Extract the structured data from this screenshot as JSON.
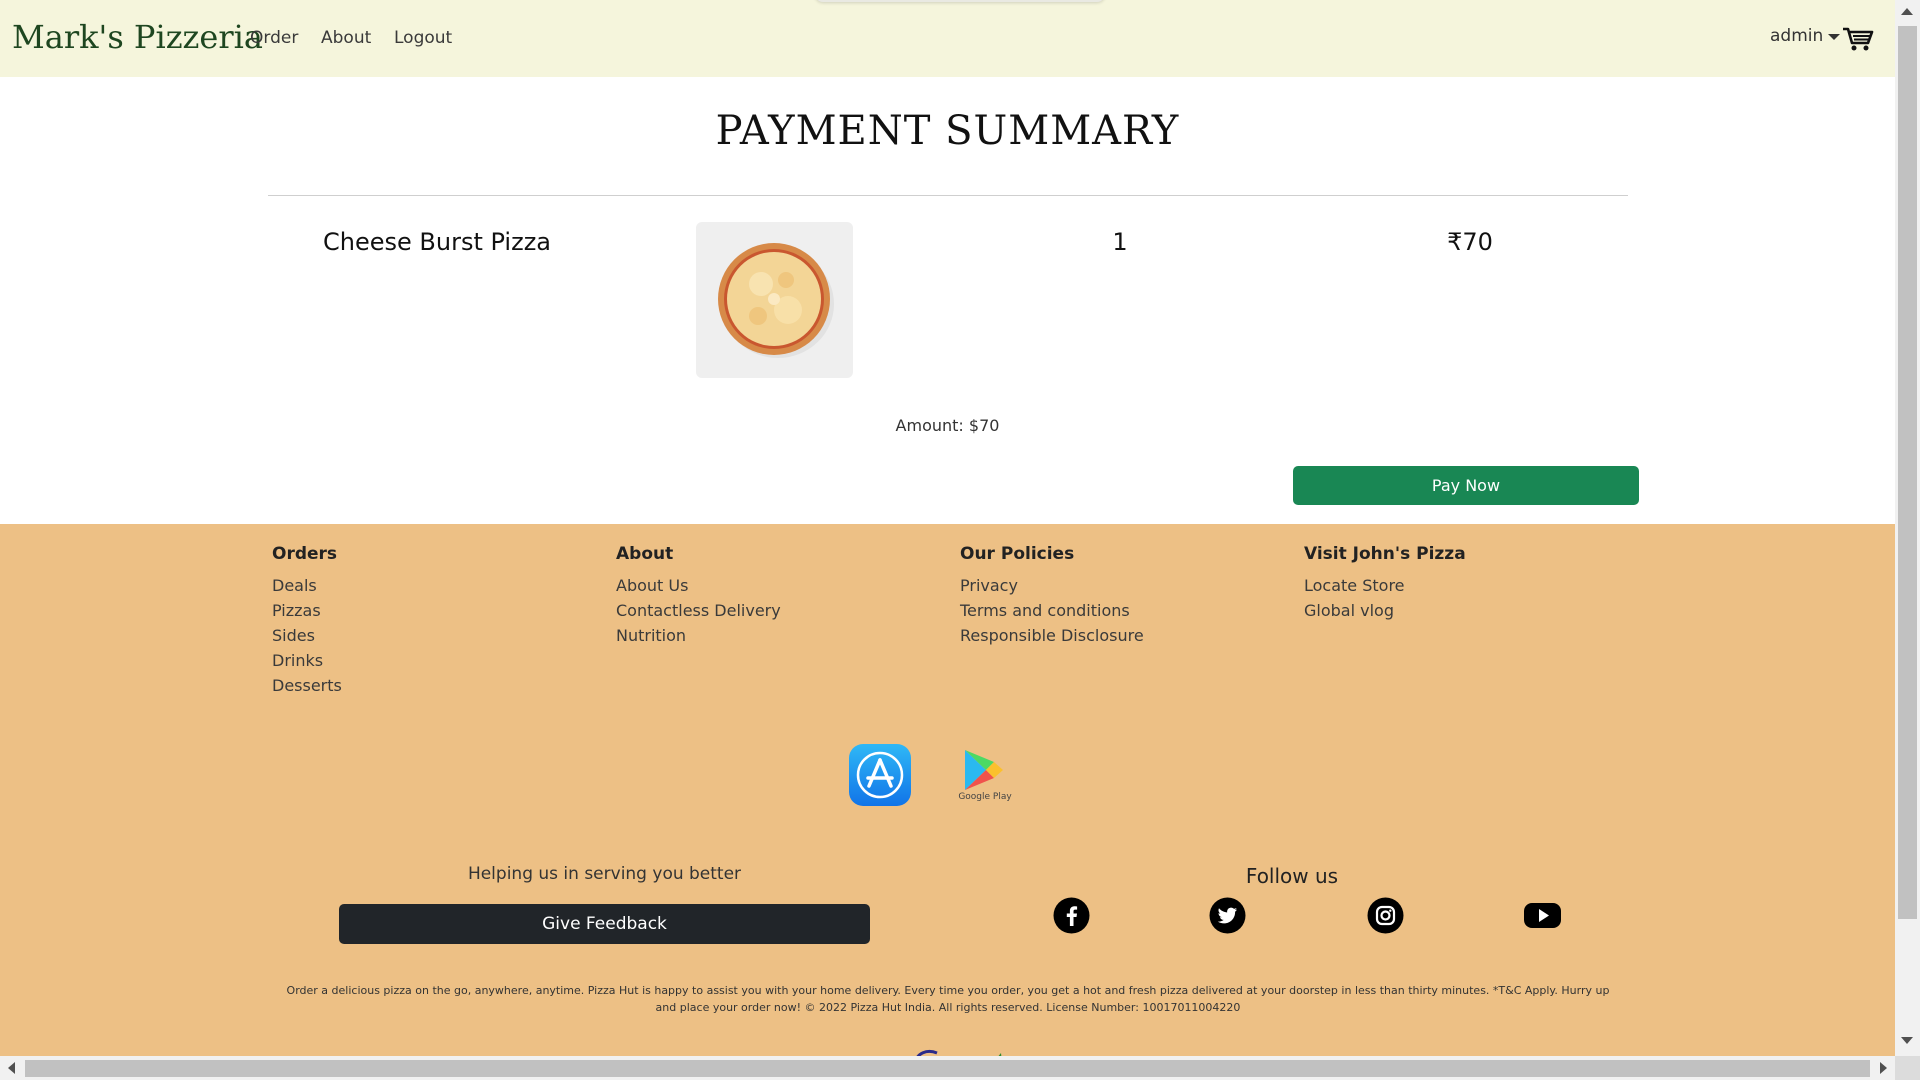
{
  "navbar": {
    "brand": "Mark's Pizzeria",
    "links": [
      "Order",
      "About",
      "Logout"
    ],
    "user": "admin"
  },
  "main": {
    "title": "PAYMENT SUMMARY",
    "item": {
      "name": "Cheese Burst Pizza",
      "quantity": "1",
      "price": "₹70"
    },
    "amount": "Amount: $70",
    "pay_label": "Pay Now"
  },
  "footer": {
    "columns": [
      {
        "heading": "Orders",
        "links": [
          "Deals",
          "Pizzas",
          "Sides",
          "Drinks",
          "Desserts"
        ]
      },
      {
        "heading": "About",
        "links": [
          "About Us",
          "Contactless Delivery",
          "Nutrition"
        ]
      },
      {
        "heading": "Our Policies",
        "links": [
          "Privacy",
          "Terms and conditions",
          "Responsible Disclosure"
        ]
      },
      {
        "heading": "Visit John's Pizza",
        "links": [
          "Locate Store",
          "Global vlog"
        ]
      }
    ],
    "google_play_label": "Google Play",
    "help_text": "Helping us in serving you better",
    "feedback_label": "Give Feedback",
    "follow_title": "Follow us",
    "legal": "Order a delicious pizza on the go, anywhere, anytime. Pizza Hut is happy to assist you with your home delivery. Every time you order, you get a hot and fresh pizza delivered at your doorstep in less than thirty minutes. *T&C Apply. Hurry up and place your order now! © 2022 Pizza Hut India. All rights reserved. License Number: 10017011004220"
  },
  "colors": {
    "navbar_bg": "#f5f5dc",
    "brand": "#1e4620",
    "pay_button": "#198754",
    "footer_bg": "#edc085",
    "feedback_button": "#212529"
  },
  "icons": [
    "cart-icon",
    "app-store-icon",
    "google-play-icon",
    "facebook-icon",
    "twitter-icon",
    "instagram-icon",
    "youtube-icon"
  ]
}
